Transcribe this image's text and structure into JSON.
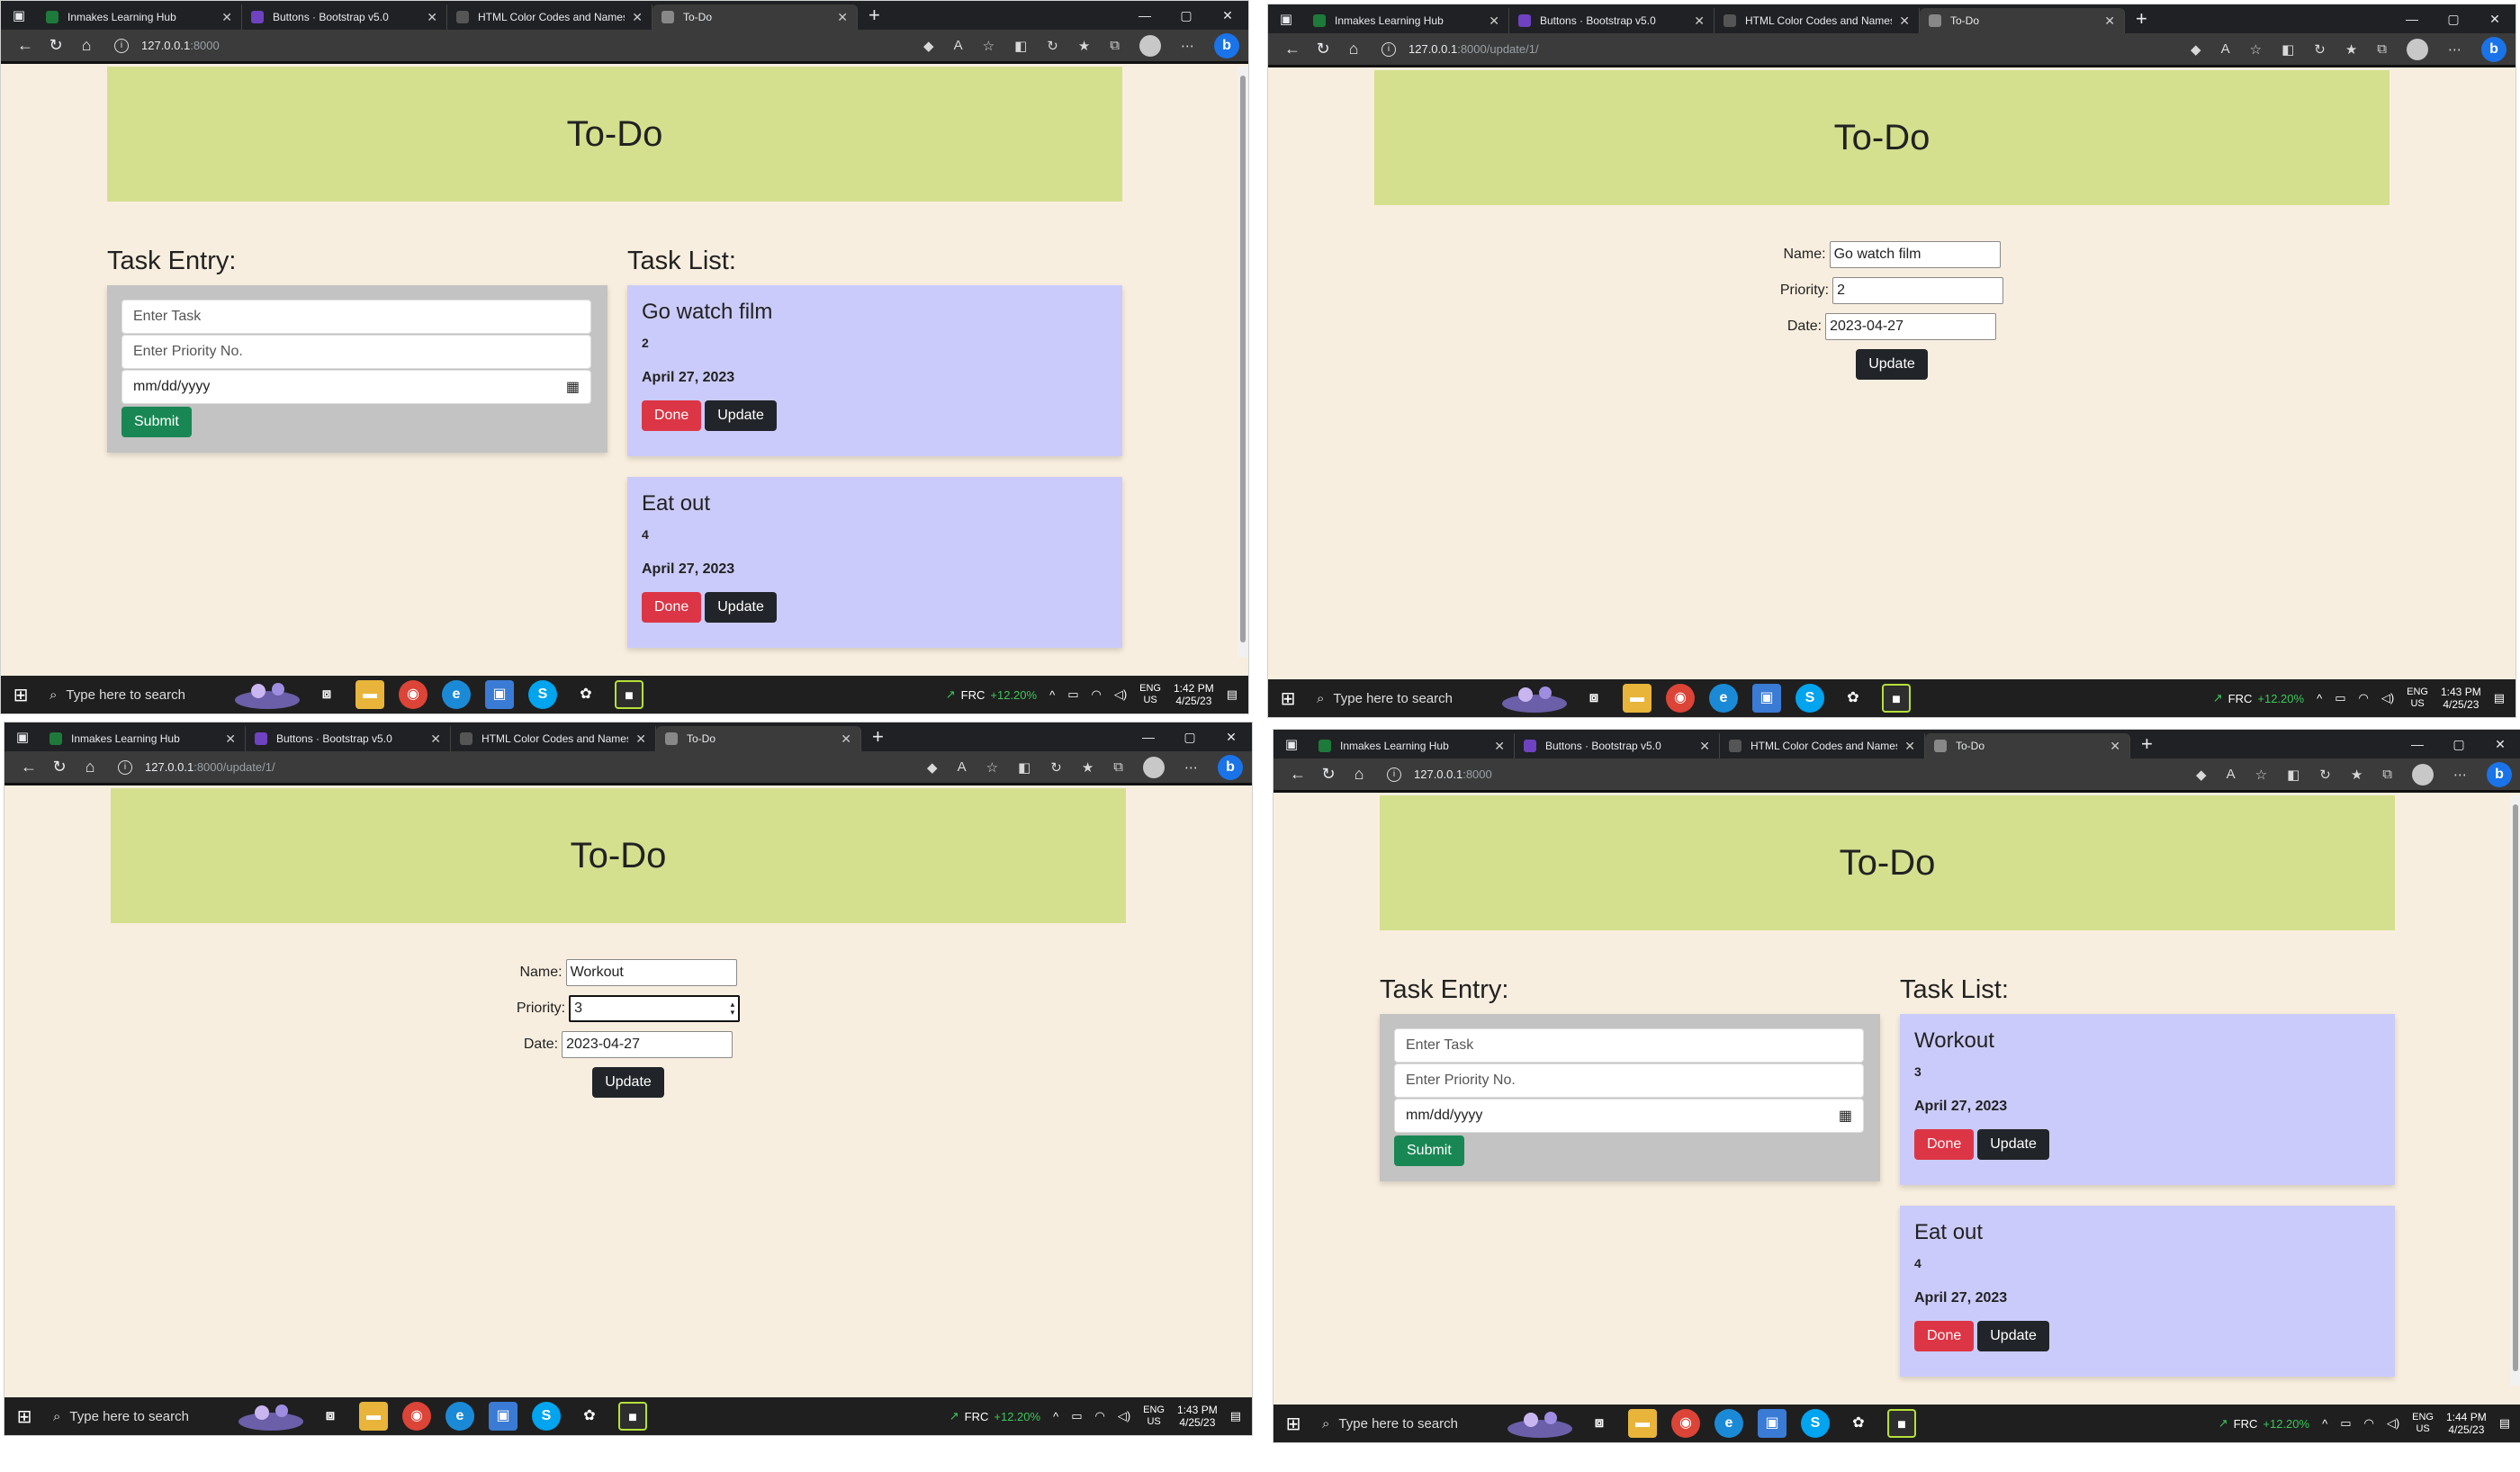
{
  "tabs": [
    {
      "label": "Inmakes Learning Hub",
      "color": "#1e7a3a"
    },
    {
      "label": "Buttons · Bootstrap v5.0",
      "color": "#6f42c1"
    },
    {
      "label": "HTML Color Codes and Names",
      "color": "#2a2a2a"
    },
    {
      "label": "To-Do",
      "color": "#5f6368"
    }
  ],
  "window": {
    "minimize": "—",
    "restore": "▢",
    "close": "✕",
    "new_tab": "+"
  },
  "nav": {
    "back": "←",
    "reload": "↻",
    "home": "⌂"
  },
  "url": {
    "host": "127.0.0.1",
    "port_home": ":8000",
    "port_update": ":8000/update/1/"
  },
  "page": {
    "title": "To-Do"
  },
  "entry": {
    "title": "Task Entry:",
    "task_placeholder": "Enter Task",
    "priority_placeholder": "Enter Priority No.",
    "date_placeholder": "mm/dd/yyyy",
    "submit_label": "Submit"
  },
  "list": {
    "title": "Task List:"
  },
  "buttons": {
    "done": "Done",
    "update": "Update"
  },
  "screens": [
    {
      "tasks": [
        {
          "name": "Go watch film",
          "priority": "2",
          "date": "April 27, 2023"
        },
        {
          "name": "Eat out",
          "priority": "4",
          "date": "April 27, 2023"
        }
      ],
      "clock_time": "1:42 PM"
    },
    {
      "form": {
        "name_label": "Name:",
        "name": "Go watch film",
        "priority_label": "Priority:",
        "priority": "2",
        "date_label": "Date:",
        "date": "2023-04-27"
      },
      "clock_time": "1:43 PM"
    },
    {
      "form": {
        "name_label": "Name:",
        "name": "Workout",
        "priority_label": "Priority:",
        "priority": "3",
        "date_label": "Date:",
        "date": "2023-04-27"
      },
      "clock_time": "1:43 PM"
    },
    {
      "tasks": [
        {
          "name": "Workout",
          "priority": "3",
          "date": "April 27, 2023"
        },
        {
          "name": "Eat out",
          "priority": "4",
          "date": "April 27, 2023"
        }
      ],
      "clock_time": "1:44 PM"
    }
  ],
  "taskbar": {
    "search_placeholder": "Type here to search",
    "stock_symbol": "FRC",
    "stock_change": "+12.20%",
    "lang_line1": "ENG",
    "lang_line2": "US",
    "clock_date": "4/25/23"
  },
  "colors": {
    "banner": "#d4e08e",
    "card": "#cbcbfb",
    "submit": "#198754",
    "done": "#dc3545",
    "update": "#212529"
  }
}
